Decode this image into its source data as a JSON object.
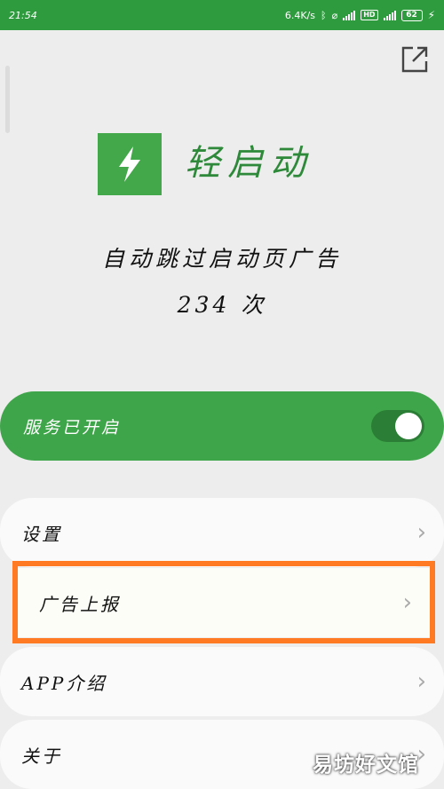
{
  "status_bar": {
    "time": "21:54",
    "net_speed": "6.4K/s",
    "hd": "HD",
    "battery": "62"
  },
  "app": {
    "name": "轻启动",
    "brand_color": "#43a84a"
  },
  "stats": {
    "skip_text": "自动跳过启动页广告",
    "count_text": "234 次"
  },
  "service": {
    "label": "服务已开启",
    "enabled": true
  },
  "menu": {
    "items": [
      {
        "label": "设置"
      },
      {
        "label": "广告上报"
      },
      {
        "label": "APP介绍"
      },
      {
        "label": "关于"
      }
    ]
  },
  "watermark": {
    "text": "易坊好文馆"
  },
  "icons": {
    "share": "share-external-icon",
    "logo": "lightning-bolt-icon",
    "chevron": "chevron-right-icon"
  },
  "colors": {
    "highlight": "#ff7a22",
    "status_bar": "#2f9b3f"
  }
}
